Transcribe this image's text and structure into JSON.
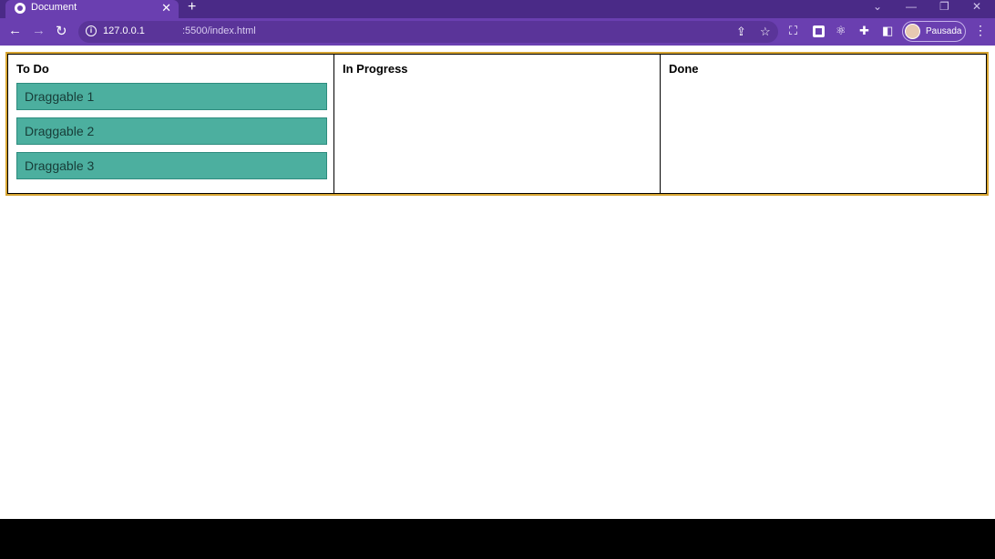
{
  "browser": {
    "tab_title": "Document",
    "tab_close": "✕",
    "new_tab": "+",
    "url_host": "127.0.0.1",
    "url_path": ":5500/index.html",
    "profile_name": "Pausada"
  },
  "board": {
    "columns": [
      {
        "title": "To Do",
        "cards": [
          "Draggable 1",
          "Draggable 2",
          "Draggable 3"
        ]
      },
      {
        "title": "In Progress",
        "cards": []
      },
      {
        "title": "Done",
        "cards": []
      }
    ]
  },
  "colors": {
    "browser_frame": "#6a3fb0",
    "card": "#4caf9f",
    "board_border": "#d6a432"
  }
}
